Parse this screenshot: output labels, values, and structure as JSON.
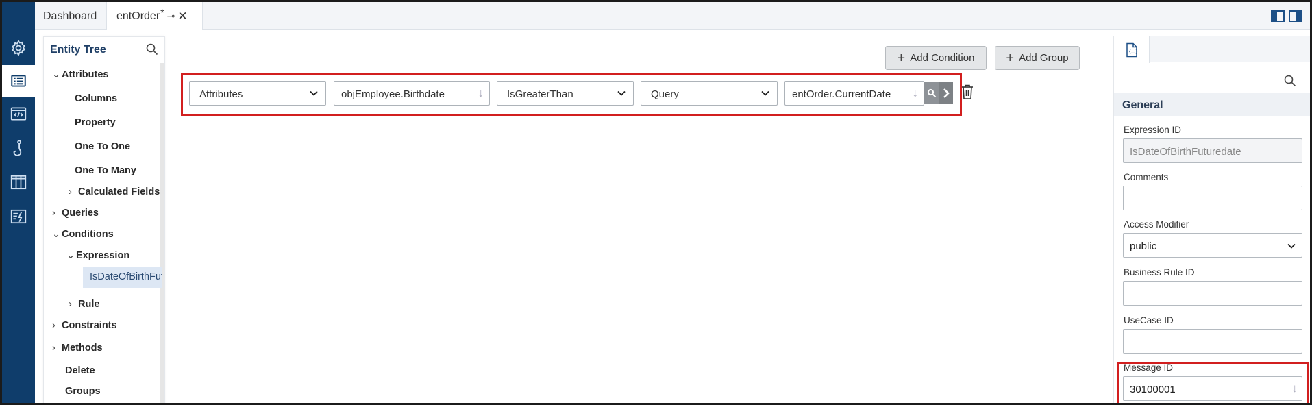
{
  "tabs": {
    "dashboard": "Dashboard",
    "active": "entOrder",
    "modified_marker": "*"
  },
  "rail": {
    "icons": [
      "gear-icon",
      "entity-list-icon",
      "code-icon",
      "hook-icon",
      "columns-icon",
      "rule-icon"
    ],
    "active_index": 1
  },
  "tree": {
    "title": "Entity Tree",
    "items": {
      "attributes": "Attributes",
      "columns": "Columns",
      "property": "Property",
      "one_to_one": "One To One",
      "one_to_many": "One To Many",
      "calculated_fields": "Calculated Fields",
      "queries": "Queries",
      "conditions": "Conditions",
      "expression": "Expression",
      "selected_expression": "IsDateOfBirthFuturedate",
      "rule": "Rule",
      "constraints": "Constraints",
      "methods": "Methods",
      "delete": "Delete",
      "groups": "Groups"
    }
  },
  "toolbar": {
    "add_condition": "Add Condition",
    "add_group": "Add Group"
  },
  "condition": {
    "source_type": "Attributes",
    "left_operand": "objEmployee.Birthdate",
    "operator": "IsGreaterThan",
    "right_type": "Query",
    "right_operand": "entOrder.CurrentDate"
  },
  "properties": {
    "section": "General",
    "expression_id_label": "Expression ID",
    "expression_id_value": "IsDateOfBirthFuturedate",
    "comments_label": "Comments",
    "comments_value": "",
    "access_modifier_label": "Access Modifier",
    "access_modifier_value": "public",
    "business_rule_id_label": "Business Rule ID",
    "business_rule_id_value": "",
    "usecase_id_label": "UseCase ID",
    "usecase_id_value": "",
    "message_id_label": "Message ID",
    "message_id_value": "30100001"
  },
  "colors": {
    "rail": "#0f3d6b",
    "highlight": "#d21f1f",
    "selected_node": "#dde7f4"
  }
}
